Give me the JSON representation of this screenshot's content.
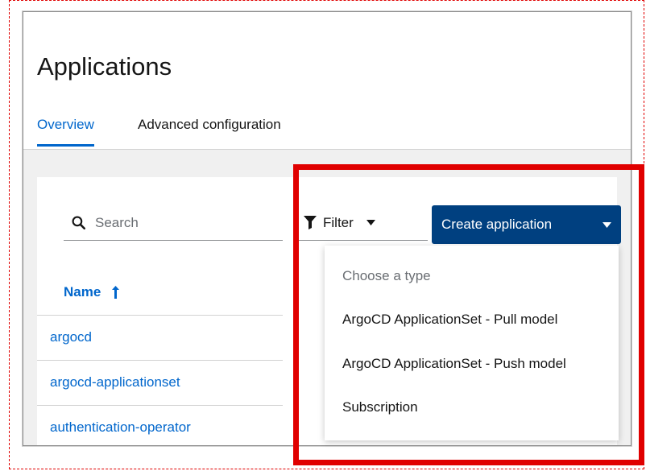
{
  "page": {
    "title": "Applications",
    "tabs": [
      {
        "label": "Overview",
        "active": true
      },
      {
        "label": "Advanced configuration",
        "active": false
      }
    ]
  },
  "toolbar": {
    "search": {
      "placeholder": "Search",
      "value": "",
      "icon": "search-icon"
    },
    "filter": {
      "label": "Filter",
      "icon": "filter-icon"
    },
    "create_button": {
      "label": "Create application",
      "icon": "caret-down-icon"
    }
  },
  "table": {
    "column_name": {
      "label": "Name",
      "sort": "ascending",
      "icon": "sort-ascending-icon"
    },
    "rows": [
      {
        "name": "argocd"
      },
      {
        "name": "argocd-applicationset"
      },
      {
        "name": "authentication-operator"
      }
    ]
  },
  "dropdown": {
    "header": "Choose a type",
    "items": [
      {
        "label": "ArgoCD ApplicationSet - Pull model"
      },
      {
        "label": "ArgoCD ApplicationSet - Push model"
      },
      {
        "label": "Subscription"
      }
    ]
  },
  "colors": {
    "brand_blue": "#0066cc",
    "button_blue": "#004080",
    "annotation_red": "#e00000"
  }
}
